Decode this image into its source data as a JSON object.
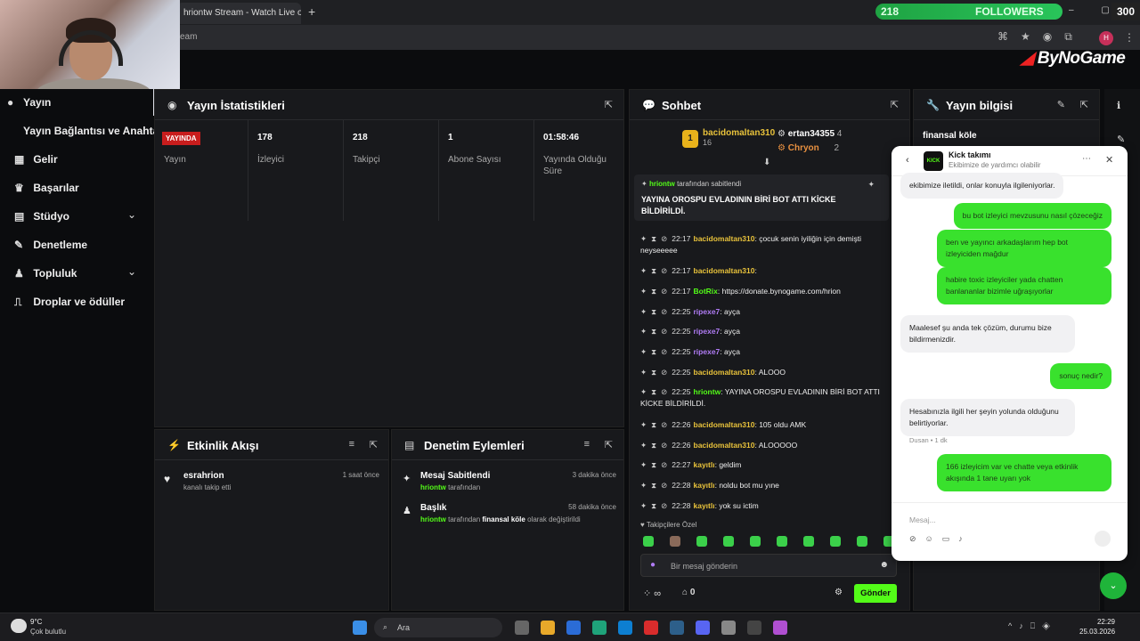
{
  "browser": {
    "tab_title": "hriontw Stream - Watch Live on",
    "new_tab": "+",
    "address": "eam",
    "followers_count": "218",
    "followers_label": "FOLLOWERS",
    "score": "300"
  },
  "brand": {
    "logo_left": "By",
    "logo_right": "NoGame"
  },
  "sidebar": {
    "items": [
      {
        "label": "Yayın",
        "icon": "●"
      },
      {
        "label": "Yayın Bağlantısı ve Anahtarı",
        "icon": ""
      },
      {
        "label": "Gelir",
        "icon": "▦"
      },
      {
        "label": "Başarılar",
        "icon": "🏆"
      },
      {
        "label": "Stüdyo",
        "icon": "▤"
      },
      {
        "label": "Denetleme",
        "icon": "🔧"
      },
      {
        "label": "Topluluk",
        "icon": "👥"
      },
      {
        "label": "Droplar ve ödüller",
        "icon": "⎍"
      }
    ],
    "chevron": "⌄"
  },
  "stats": {
    "title": "Yayın İstatistikleri",
    "live_badge": "YAYINDA",
    "cols": [
      {
        "value": "",
        "label": "Yayın"
      },
      {
        "value": "178",
        "label": "İzleyici"
      },
      {
        "value": "218",
        "label": "Takipçi"
      },
      {
        "value": "1",
        "label": "Abone Sayısı"
      },
      {
        "value": "01:58:46",
        "label": "Yayında Olduğu Süre"
      }
    ]
  },
  "activity": {
    "title": "Etkinlik Akışı",
    "items": [
      {
        "name": "esrahrion",
        "desc": "kanalı takip etti",
        "time": "1 saat önce"
      }
    ]
  },
  "moderation": {
    "title": "Denetim Eylemleri",
    "items": [
      {
        "title": "Mesaj Sabitlendi",
        "user": "hriontw",
        "desc": "tarafından",
        "time": "3 dakika önce"
      },
      {
        "title": "Başlık",
        "user": "hriontw",
        "desc": "tarafından",
        "bold": "finansal köle",
        "desc2": "olarak değiştirildi",
        "time": "58 dakika önce"
      }
    ]
  },
  "chat": {
    "title": "Sohbet",
    "top_gifters": [
      {
        "name": "bacidomaltan310",
        "count": "16"
      },
      {
        "name": "ertan34355",
        "count": "4"
      },
      {
        "name": "Chryon",
        "count": "2"
      }
    ],
    "pinned_by": "hriontw",
    "pinned_by_suffix": "tarafından sabitlendi",
    "pinned_text": "YAYINA OROSPU EVLADININ BİRİ BOT ATTI KİCKE BİLDİRİLDİ.",
    "messages": [
      {
        "time": "22:17",
        "user": "bacidomaltan310",
        "color": "y",
        "text": ": çocuk senin iyiliğin için demişti neyseeeee"
      },
      {
        "time": "22:17",
        "user": "bacidomaltan310",
        "color": "y",
        "text": ":"
      },
      {
        "time": "22:17",
        "user": "BotRix",
        "color": "g",
        "text": ": https://donate.bynogame.com/hrion"
      },
      {
        "time": "22:25",
        "user": "ripexe7",
        "color": "p",
        "text": ": ayça"
      },
      {
        "time": "22:25",
        "user": "ripexe7",
        "color": "p",
        "text": ": ayça"
      },
      {
        "time": "22:25",
        "user": "ripexe7",
        "color": "p",
        "text": ": ayça"
      },
      {
        "time": "22:25",
        "user": "bacidomaltan310",
        "color": "y",
        "text": ": ALOOO"
      },
      {
        "time": "22:25",
        "user": "hriontw",
        "color": "g",
        "text": ": YAYINA OROSPU EVLADININ BİRİ BOT ATTI KİCKE BİLDİRİLDİ."
      },
      {
        "time": "22:26",
        "user": "bacidomaltan310",
        "color": "y",
        "text": ": 105 oldu AMK"
      },
      {
        "time": "22:26",
        "user": "bacidomaltan310",
        "color": "y",
        "text": ": ALOOOOO"
      },
      {
        "time": "22:27",
        "user": "kayıtlı",
        "color": "y",
        "text": ": geldim"
      },
      {
        "time": "22:28",
        "user": "kayıtlı",
        "color": "y",
        "text": ": noldu bot mu yıne"
      },
      {
        "time": "22:28",
        "user": "kayıtlı",
        "color": "y",
        "text": ": yok su ictim"
      }
    ],
    "followers_only": "Takipçilere Özel",
    "input_placeholder": "Bir mesaj gönderin",
    "infinity": "∞",
    "points": "0",
    "send_label": "Gönder"
  },
  "info": {
    "title": "Yayın bilgisi",
    "stream_title": "finansal köle"
  },
  "support": {
    "title": "Kick takımı",
    "subtitle": "Ekibimize de yardımcı olabilir",
    "logo": "KICK",
    "messages": [
      {
        "side": "l",
        "text": "ekibimize iletildi, onlar konuyla ilgileniyorlar."
      },
      {
        "side": "r",
        "text": "bu bot izleyici mevzusunu nasıl çözeceğiz"
      },
      {
        "side": "r",
        "text": "ben ve yayıncı arkadaşlarım hep bot izleyiciden mağdur"
      },
      {
        "side": "r",
        "text": "habire toxic izleyiciler yada chatten banlananlar bizimle uğraşıyorlar"
      },
      {
        "side": "l",
        "text": "Maalesef şu anda tek çözüm, durumu bize bildirmenizdir."
      },
      {
        "side": "r",
        "text": "sonuç nedir?"
      },
      {
        "side": "l",
        "text": "Hesabınızla ilgili her şeyin yolunda olduğunu belirtiyorlar."
      },
      {
        "side": "r",
        "text": "166 izleyicim var ve chatte veya etkinlik akışında 1 tane uyarı yok"
      }
    ],
    "author": "Dusan • 1 dk",
    "input_placeholder": "Mesaj..."
  },
  "taskbar": {
    "weather_temp": "9°C",
    "weather_desc": "Çok bulutlu",
    "search": "Ara",
    "time": "22:29",
    "date": "25.03.2026"
  }
}
